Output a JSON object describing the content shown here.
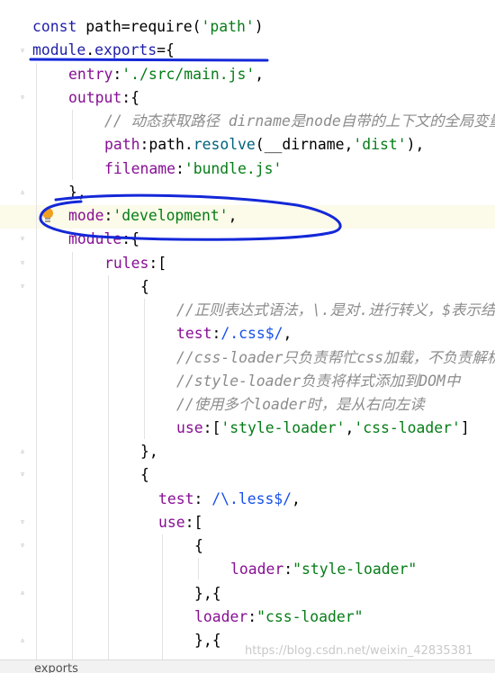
{
  "code": {
    "l1": [
      {
        "t": "const ",
        "c": "kw"
      },
      {
        "t": "path",
        "c": ""
      },
      {
        "t": "=",
        "c": ""
      },
      {
        "t": "require",
        "c": ""
      },
      {
        "t": "(",
        "c": ""
      },
      {
        "t": "'path'",
        "c": "str"
      },
      {
        "t": ")",
        "c": ""
      }
    ],
    "l2": [
      {
        "t": "module",
        "c": "kw"
      },
      {
        "t": ".",
        "c": ""
      },
      {
        "t": "exports",
        "c": "kw"
      },
      {
        "t": "={",
        "c": ""
      }
    ],
    "l3": [
      {
        "t": "entry",
        "c": "prop"
      },
      {
        "t": ":",
        "c": ""
      },
      {
        "t": "'./src/main.js'",
        "c": "str"
      },
      {
        "t": ",",
        "c": ""
      }
    ],
    "l4": [
      {
        "t": "output",
        "c": "prop"
      },
      {
        "t": ":{",
        "c": ""
      }
    ],
    "l5": [
      {
        "t": "// 动态获取路径 dirname是node自带的上下文的全局变量",
        "c": "cmt"
      }
    ],
    "l6": [
      {
        "t": "path",
        "c": "prop"
      },
      {
        "t": ":",
        "c": ""
      },
      {
        "t": "path",
        "c": ""
      },
      {
        "t": ".",
        "c": ""
      },
      {
        "t": "resolve",
        "c": "fn"
      },
      {
        "t": "(",
        "c": ""
      },
      {
        "t": "__dirname",
        "c": ""
      },
      {
        "t": ",",
        "c": ""
      },
      {
        "t": "'dist'",
        "c": "str"
      },
      {
        "t": "),",
        "c": ""
      }
    ],
    "l7": [
      {
        "t": "filename",
        "c": "prop"
      },
      {
        "t": ":",
        "c": ""
      },
      {
        "t": "'bundle.js'",
        "c": "str"
      }
    ],
    "l8": [
      {
        "t": "},",
        "c": ""
      }
    ],
    "l9": [
      {
        "t": "mode",
        "c": "prop"
      },
      {
        "t": ":",
        "c": ""
      },
      {
        "t": "'development'",
        "c": "str"
      },
      {
        "t": ",",
        "c": ""
      }
    ],
    "l10": [
      {
        "t": "module",
        "c": "prop"
      },
      {
        "t": ":{",
        "c": ""
      }
    ],
    "l11": [
      {
        "t": "rules",
        "c": "prop"
      },
      {
        "t": ":[",
        "c": ""
      }
    ],
    "l12": [
      {
        "t": "{",
        "c": ""
      }
    ],
    "l13": [
      {
        "t": "//正则表达式语法，\\.是对.进行转义，$表示结尾",
        "c": "cmt"
      }
    ],
    "l14": [
      {
        "t": "test",
        "c": "prop"
      },
      {
        "t": ":",
        "c": ""
      },
      {
        "t": "/.css$/",
        "c": "num"
      },
      {
        "t": ",",
        "c": ""
      }
    ],
    "l15": [
      {
        "t": "//css-loader只负责帮忙css加载，不负责解析",
        "c": "cmt"
      }
    ],
    "l16": [
      {
        "t": "//style-loader负责将样式添加到DOM中",
        "c": "cmt"
      }
    ],
    "l17": [
      {
        "t": "//使用多个loader时，是从右向左读",
        "c": "cmt"
      }
    ],
    "l18": [
      {
        "t": "use",
        "c": "prop"
      },
      {
        "t": ":[",
        "c": ""
      },
      {
        "t": "'style-loader'",
        "c": "str"
      },
      {
        "t": ",",
        "c": ""
      },
      {
        "t": "'css-loader'",
        "c": "str"
      },
      {
        "t": "]",
        "c": ""
      }
    ],
    "l19": [
      {
        "t": "},",
        "c": ""
      }
    ],
    "l20": [
      {
        "t": "{",
        "c": ""
      }
    ],
    "l21": [
      {
        "t": "test",
        "c": "prop"
      },
      {
        "t": ": ",
        "c": ""
      },
      {
        "t": "/\\.less$/",
        "c": "num"
      },
      {
        "t": ",",
        "c": ""
      }
    ],
    "l22": [
      {
        "t": "use",
        "c": "prop"
      },
      {
        "t": ":[",
        "c": ""
      }
    ],
    "l23": [
      {
        "t": "{",
        "c": ""
      }
    ],
    "l24": [
      {
        "t": "loader",
        "c": "prop"
      },
      {
        "t": ":",
        "c": ""
      },
      {
        "t": "\"style-loader\"",
        "c": "str"
      }
    ],
    "l25": [
      {
        "t": "},{",
        "c": ""
      }
    ],
    "l26": [
      {
        "t": "loader",
        "c": "prop"
      },
      {
        "t": ":",
        "c": ""
      },
      {
        "t": "\"css-loader\"",
        "c": "str"
      }
    ],
    "l27": [
      {
        "t": "},{",
        "c": ""
      }
    ]
  },
  "breadcrumb": "exports",
  "watermark": "https://blog.csdn.net/weixin_42835381",
  "colors": {
    "annotation_ink": "#1428d8",
    "highlight_row": "#fcfae8",
    "intention_bulb": "#f0a020"
  }
}
